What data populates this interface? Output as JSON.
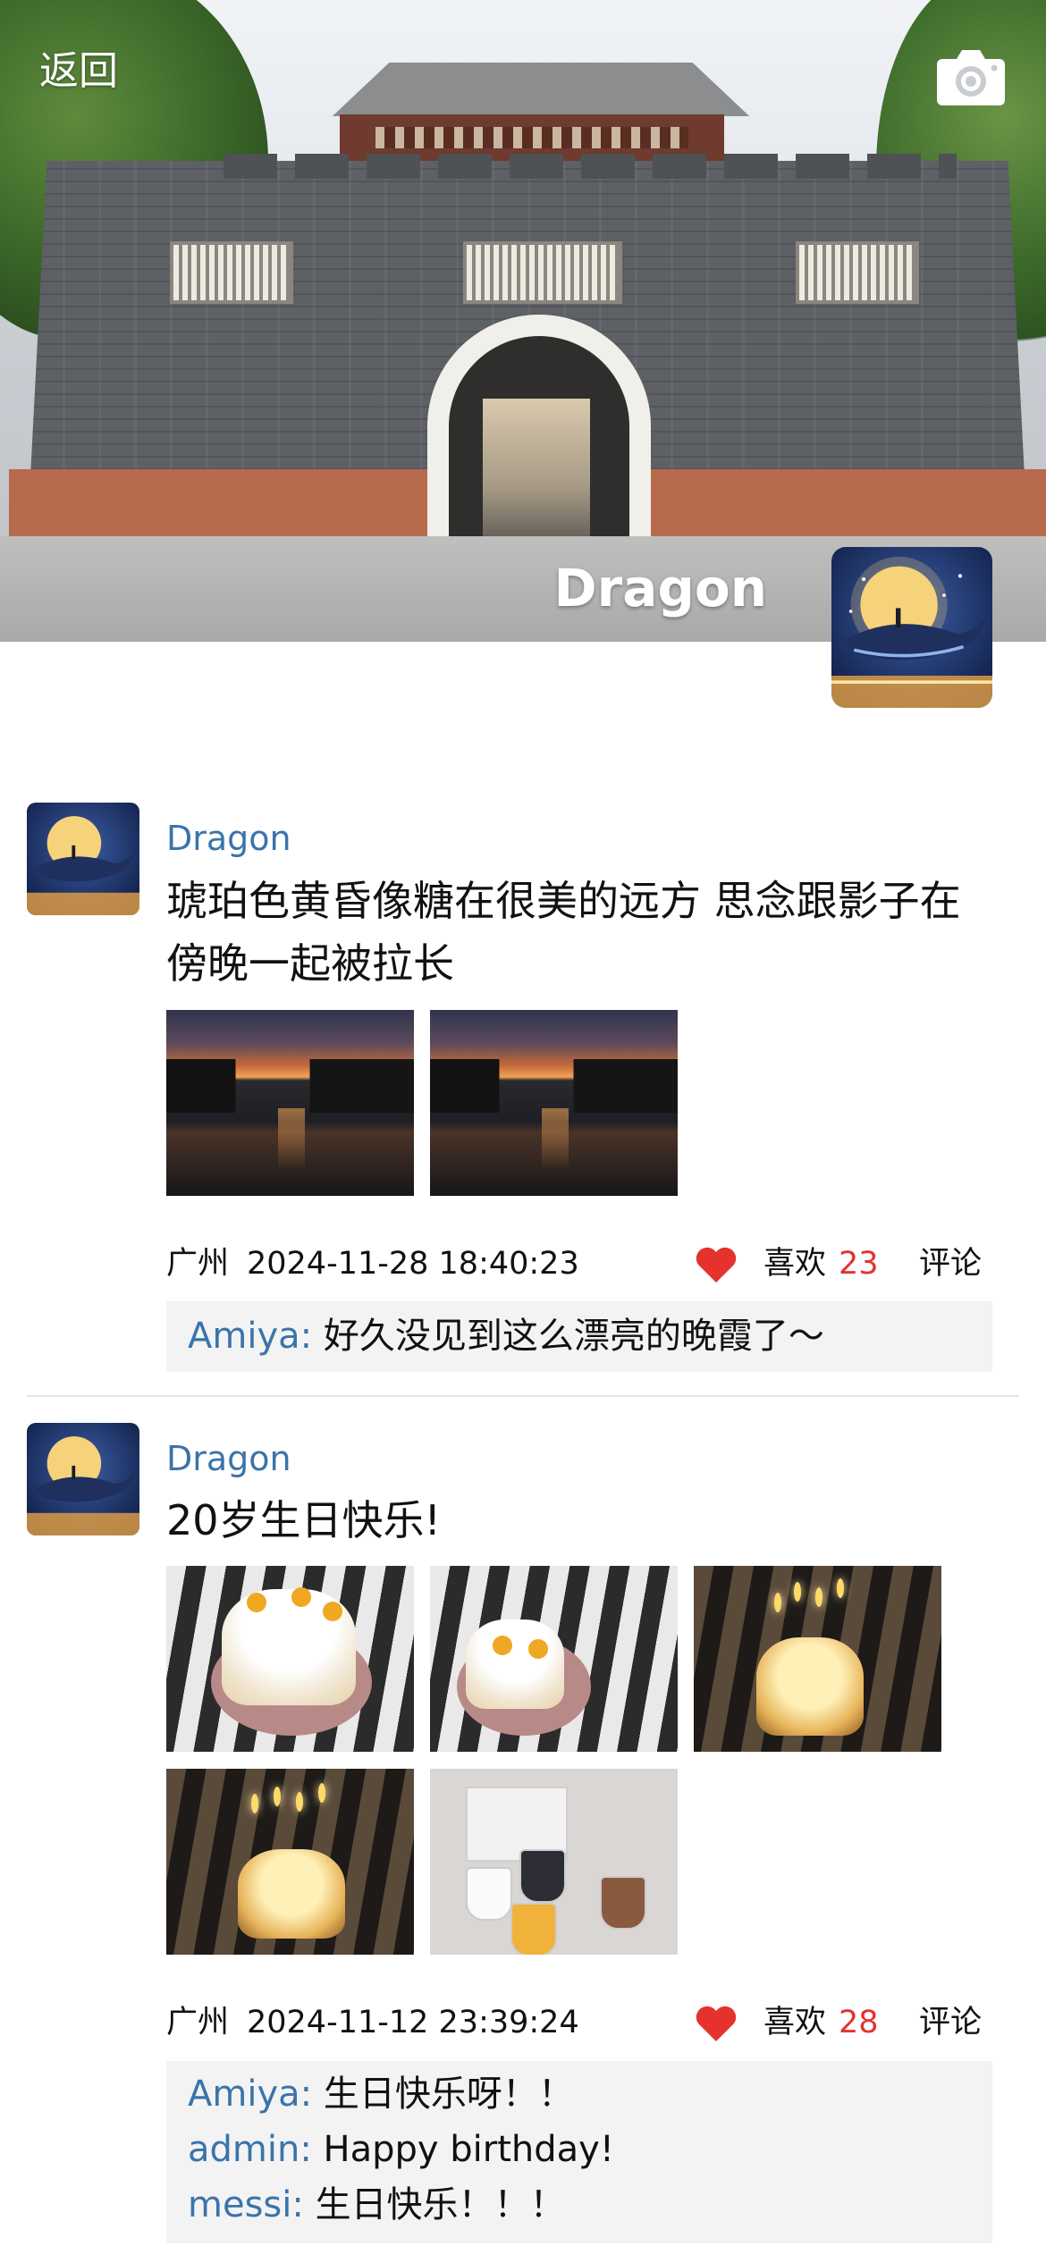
{
  "header": {
    "back_label": "返回",
    "username": "Dragon",
    "camera_icon": "camera-icon"
  },
  "colors": {
    "username_link": "#3a74aa",
    "like_count": "#e5322d",
    "heart": "#e5322d",
    "comment_bg": "#f3f3f3"
  },
  "posts": [
    {
      "author": "Dragon",
      "text": "琥珀色黄昏像糖在很美的远方 思念跟影子在傍晚一起被拉长",
      "image_count": 2,
      "location": "广州",
      "time": "2024-11-28 18:40:23",
      "like_label": "喜欢",
      "like_count": "23",
      "comment_label": "评论",
      "comments": [
        {
          "user": "Amiya:",
          "text": "好久没见到这么漂亮的晚霞了～"
        }
      ]
    },
    {
      "author": "Dragon",
      "text": "20岁生日快乐!",
      "image_count": 5,
      "location": "广州",
      "time": "2024-11-12 23:39:24",
      "like_label": "喜欢",
      "like_count": "28",
      "comment_label": "评论",
      "comments": [
        {
          "user": "Amiya:",
          "text": "生日快乐呀！！"
        },
        {
          "user": "admin:",
          "text": "Happy birthday!"
        },
        {
          "user": "messi:",
          "text": "生日快乐！！！"
        }
      ]
    }
  ]
}
